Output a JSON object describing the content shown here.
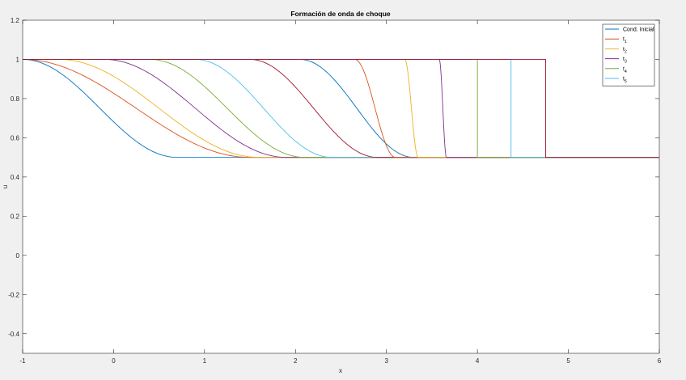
{
  "chart_data": {
    "type": "line",
    "title": "Formación de onda de choque",
    "xlabel": "x",
    "ylabel": "u",
    "xlim": [
      -1,
      6
    ],
    "ylim": [
      -0.5,
      1.2
    ],
    "xticks": [
      "-1",
      "0",
      "1",
      "2",
      "3",
      "4",
      "5",
      "6"
    ],
    "yticks": [
      "-0.4",
      "-0.2",
      "0",
      "0.2",
      "0.4",
      "0.6",
      "0.8",
      "1",
      "1.2"
    ],
    "legend_position": "top-right",
    "grid": false,
    "series": [
      {
        "name": "Cond. Inicial",
        "sub": "",
        "color": "#0072BD",
        "kind": "smooth",
        "start": -1.0,
        "end": 0.7
      },
      {
        "name": "t",
        "sub": "1",
        "color": "#D95319",
        "kind": "smooth",
        "start": -1.0,
        "end": 1.5
      },
      {
        "name": "t",
        "sub": "2",
        "color": "#EDB120",
        "kind": "smooth",
        "start": -0.6,
        "end": 1.6
      },
      {
        "name": "t",
        "sub": "3",
        "color": "#7E2F8E",
        "kind": "smooth",
        "start": -0.1,
        "end": 1.9
      },
      {
        "name": "t",
        "sub": "4",
        "color": "#77AC30",
        "kind": "smooth",
        "start": 0.4,
        "end": 2.1
      },
      {
        "name": "t",
        "sub": "5",
        "color": "#4DBEEE",
        "kind": "smooth",
        "start": 0.9,
        "end": 2.4
      },
      {
        "name": "",
        "sub": "",
        "color": "#A2142F",
        "kind": "smooth",
        "start": 1.5,
        "end": 2.9
      },
      {
        "name": "",
        "sub": "",
        "color": "#0072BD",
        "kind": "smooth",
        "start": 2.05,
        "end": 3.3
      },
      {
        "name": "",
        "sub": "",
        "color": "#D95319",
        "kind": "smooth",
        "start": 2.65,
        "end": 3.1
      },
      {
        "name": "",
        "sub": "",
        "color": "#EDB120",
        "kind": "smooth",
        "start": 3.2,
        "end": 3.35
      },
      {
        "name": "",
        "sub": "",
        "color": "#7E2F8E",
        "kind": "smooth",
        "start": 3.58,
        "end": 3.66
      },
      {
        "name": "",
        "sub": "",
        "color": "#77AC30",
        "kind": "step",
        "at": 4.0
      },
      {
        "name": "",
        "sub": "",
        "color": "#4DBEEE",
        "kind": "step",
        "at": 4.37
      },
      {
        "name": "",
        "sub": "",
        "color": "#A2142F",
        "kind": "step",
        "at": 4.75
      }
    ],
    "u_high": 1.0,
    "u_low": 0.5
  }
}
